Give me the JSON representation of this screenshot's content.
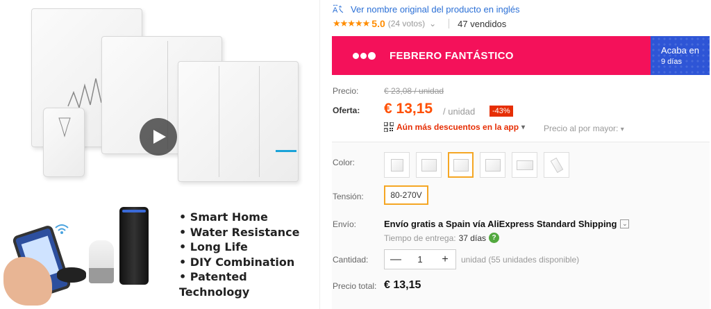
{
  "gallery": {
    "features": [
      "Smart Home",
      "Water Resistance",
      "Long Life",
      "DIY Combination",
      "Patented Technology"
    ],
    "play_icon": "play-icon"
  },
  "header": {
    "translate_link": "Ver nombre original del producto en inglés",
    "translate_icon": "translate-icon"
  },
  "rating": {
    "stars": "★★★★★",
    "value": "5.0",
    "votes": "(24 votos)",
    "votes_chevron": "⌄",
    "sold": "47 vendidos"
  },
  "promo": {
    "title": "FEBRERO FANTÁSTICO",
    "ends_label": "Acaba en",
    "ends_value": "9 días",
    "accent": "#f4115a",
    "timer_color": "#2e55d6"
  },
  "price": {
    "price_label": "Precio:",
    "old_price": "€ 23,08 / unidad",
    "offer_label": "Oferta:",
    "new_price": "€ 13,15",
    "per_unit": "/ unidad",
    "discount": "-43%",
    "app_discount": "Aún más descuentos en la app",
    "app_chevron": "▾",
    "wholesale": "Precio al por mayor:",
    "wholesale_chevron": "▾"
  },
  "options": {
    "color_label": "Color:",
    "swatch_count": 6,
    "selected_swatch": 3,
    "tension_label": "Tensión:",
    "tension_value": "80-270V",
    "shipping_label": "Envío:",
    "shipping_text": "Envío gratis a Spain vía AliExpress Standard Shipping",
    "shipping_chevron": "⌄",
    "delivery_label": "Tiempo de entrega:",
    "delivery_days": "37 días",
    "help_icon": "?",
    "quantity_label": "Cantidad:",
    "quantity_minus": "—",
    "quantity_value": "1",
    "quantity_plus": "+",
    "quantity_info": "unidad (55 unidades disponible)",
    "total_label": "Precio total:",
    "total_value": "€ 13,15",
    "selection_color": "#f5a623"
  }
}
